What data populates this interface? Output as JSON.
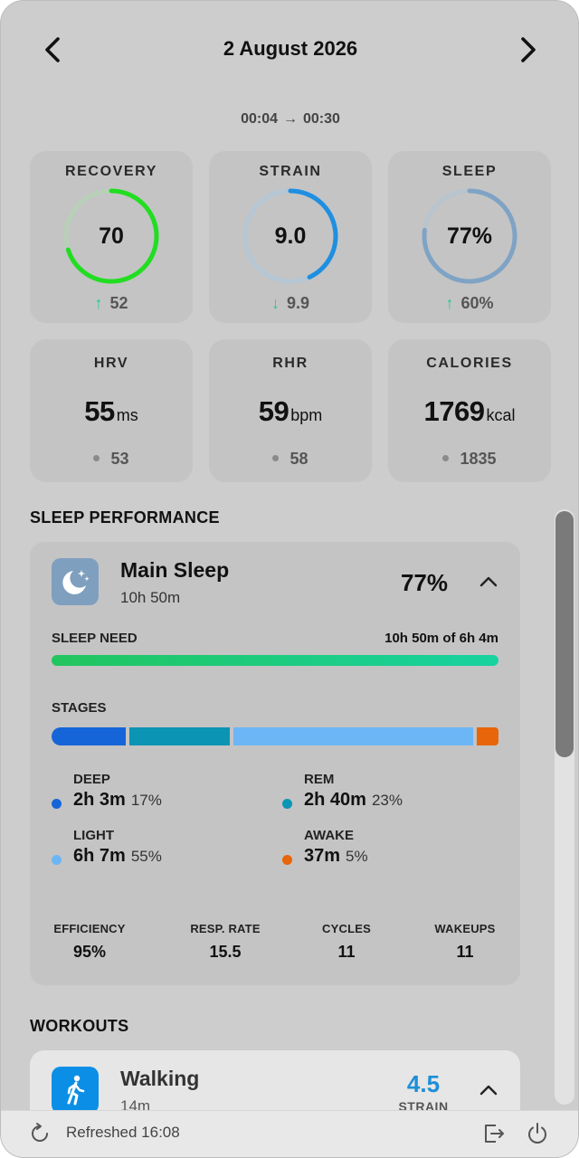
{
  "header": {
    "date": "2 August 2026",
    "time_start": "00:04",
    "time_arrow": "→",
    "time_end": "00:30"
  },
  "metrics": {
    "recovery": {
      "label": "RECOVERY",
      "value": "70",
      "trend": "52",
      "trend_dir": "up",
      "progress": 0.7,
      "color": "#22dd22"
    },
    "strain": {
      "label": "STRAIN",
      "value": "9.0",
      "trend": "9.9",
      "trend_dir": "down",
      "progress": 0.43,
      "color": "#1e8fe1"
    },
    "sleep": {
      "label": "SLEEP",
      "value": "77%",
      "trend": "60%",
      "trend_dir": "up",
      "progress": 0.77,
      "color": "#7fa3c4"
    }
  },
  "vitals": {
    "hrv": {
      "label": "HRV",
      "value": "55",
      "unit": "ms",
      "baseline": "53"
    },
    "rhr": {
      "label": "RHR",
      "value": "59",
      "unit": "bpm",
      "baseline": "58"
    },
    "calories": {
      "label": "CALORIES",
      "value": "1769",
      "unit": "kcal",
      "baseline": "1835"
    }
  },
  "sleep_section": {
    "title": "SLEEP PERFORMANCE",
    "name": "Main Sleep",
    "duration": "10h 50m",
    "performance": "77%",
    "need_label": "SLEEP NEED",
    "need_value": "10h 50m of 6h 4m",
    "need_progress": 1.0,
    "stages_label": "STAGES",
    "stages": [
      {
        "name": "DEEP",
        "value": "2h 3m",
        "pct": "17%",
        "fraction": 0.17,
        "color": "#1565d8"
      },
      {
        "name": "REM",
        "value": "2h 40m",
        "pct": "23%",
        "fraction": 0.23,
        "color": "#0b94b4"
      },
      {
        "name": "LIGHT",
        "value": "6h 7m",
        "pct": "55%",
        "fraction": 0.55,
        "color": "#6cb6f5"
      },
      {
        "name": "AWAKE",
        "value": "37m",
        "pct": "5%",
        "fraction": 0.05,
        "color": "#e8650a"
      }
    ],
    "stats": [
      {
        "label": "EFFICIENCY",
        "value": "95%"
      },
      {
        "label": "RESP. RATE",
        "value": "15.5"
      },
      {
        "label": "CYCLES",
        "value": "11"
      },
      {
        "label": "WAKEUPS",
        "value": "11"
      }
    ]
  },
  "workouts": {
    "title": "WORKOUTS",
    "items": [
      {
        "name": "Walking",
        "duration": "14m",
        "strain": "4.5",
        "strain_label": "STRAIN",
        "icon": "walking-icon"
      }
    ]
  },
  "footer": {
    "refreshed": "Refreshed 16:08"
  },
  "scroll": {
    "position": 0.0,
    "visible_fraction": 0.41
  }
}
